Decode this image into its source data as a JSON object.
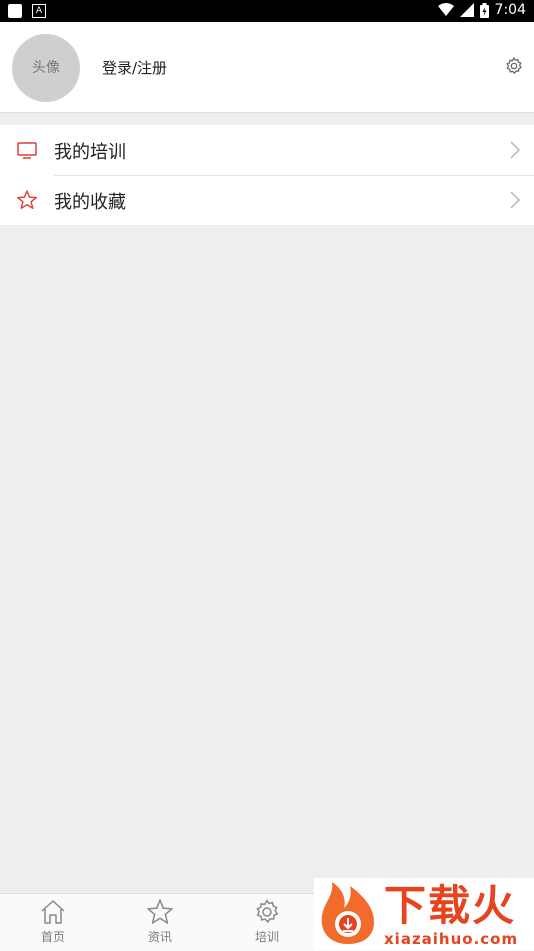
{
  "status_bar": {
    "time": "7:04",
    "notif_letter": "A"
  },
  "profile": {
    "avatar_text": "头像",
    "login_text": "登录/注册"
  },
  "menu": {
    "items": [
      {
        "label": "我的培训",
        "icon": "tv-icon"
      },
      {
        "label": "我的收藏",
        "icon": "star-outline-icon"
      }
    ]
  },
  "tabbar": {
    "tabs": [
      {
        "label": "首页",
        "icon": "home-icon"
      },
      {
        "label": "资讯",
        "icon": "star-icon"
      },
      {
        "label": "培训",
        "icon": "gear-icon"
      }
    ]
  },
  "watermark": {
    "title": "下载火",
    "url": "xiazaihuo.com"
  },
  "colors": {
    "accent": "#e8431f",
    "icon_red": "#e53935",
    "background": "#eeeeee"
  }
}
